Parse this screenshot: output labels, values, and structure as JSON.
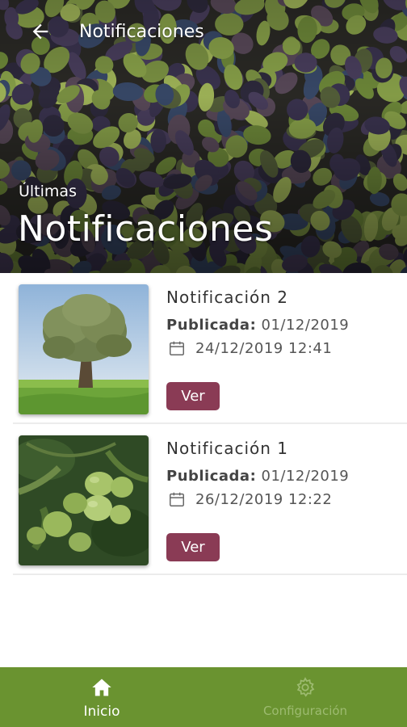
{
  "app": {
    "topbar_title": "Notificaciones",
    "hero_subtitle": "Últimas",
    "hero_title": "Notificaciones"
  },
  "notifications": [
    {
      "title": "Notificación 2",
      "published_label": "Publicada:",
      "published_date": "01/12/2019",
      "datetime": "24/12/2019 12:41",
      "button_label": "Ver",
      "image": "olive-tree-photo"
    },
    {
      "title": "Notificación 1",
      "published_label": "Publicada:",
      "published_date": "01/12/2019",
      "datetime": "26/12/2019 12:22",
      "button_label": "Ver",
      "image": "green-olives-branch-photo"
    }
  ],
  "bottom_nav": {
    "items": [
      {
        "label": "Inicio",
        "icon": "home-icon",
        "active": true
      },
      {
        "label": "Configuración",
        "icon": "gear-icon",
        "active": false
      }
    ]
  },
  "colors": {
    "nav_bg": "#6a9330",
    "button_bg": "#8a3b55",
    "nav_inactive": "#9dbb70"
  }
}
